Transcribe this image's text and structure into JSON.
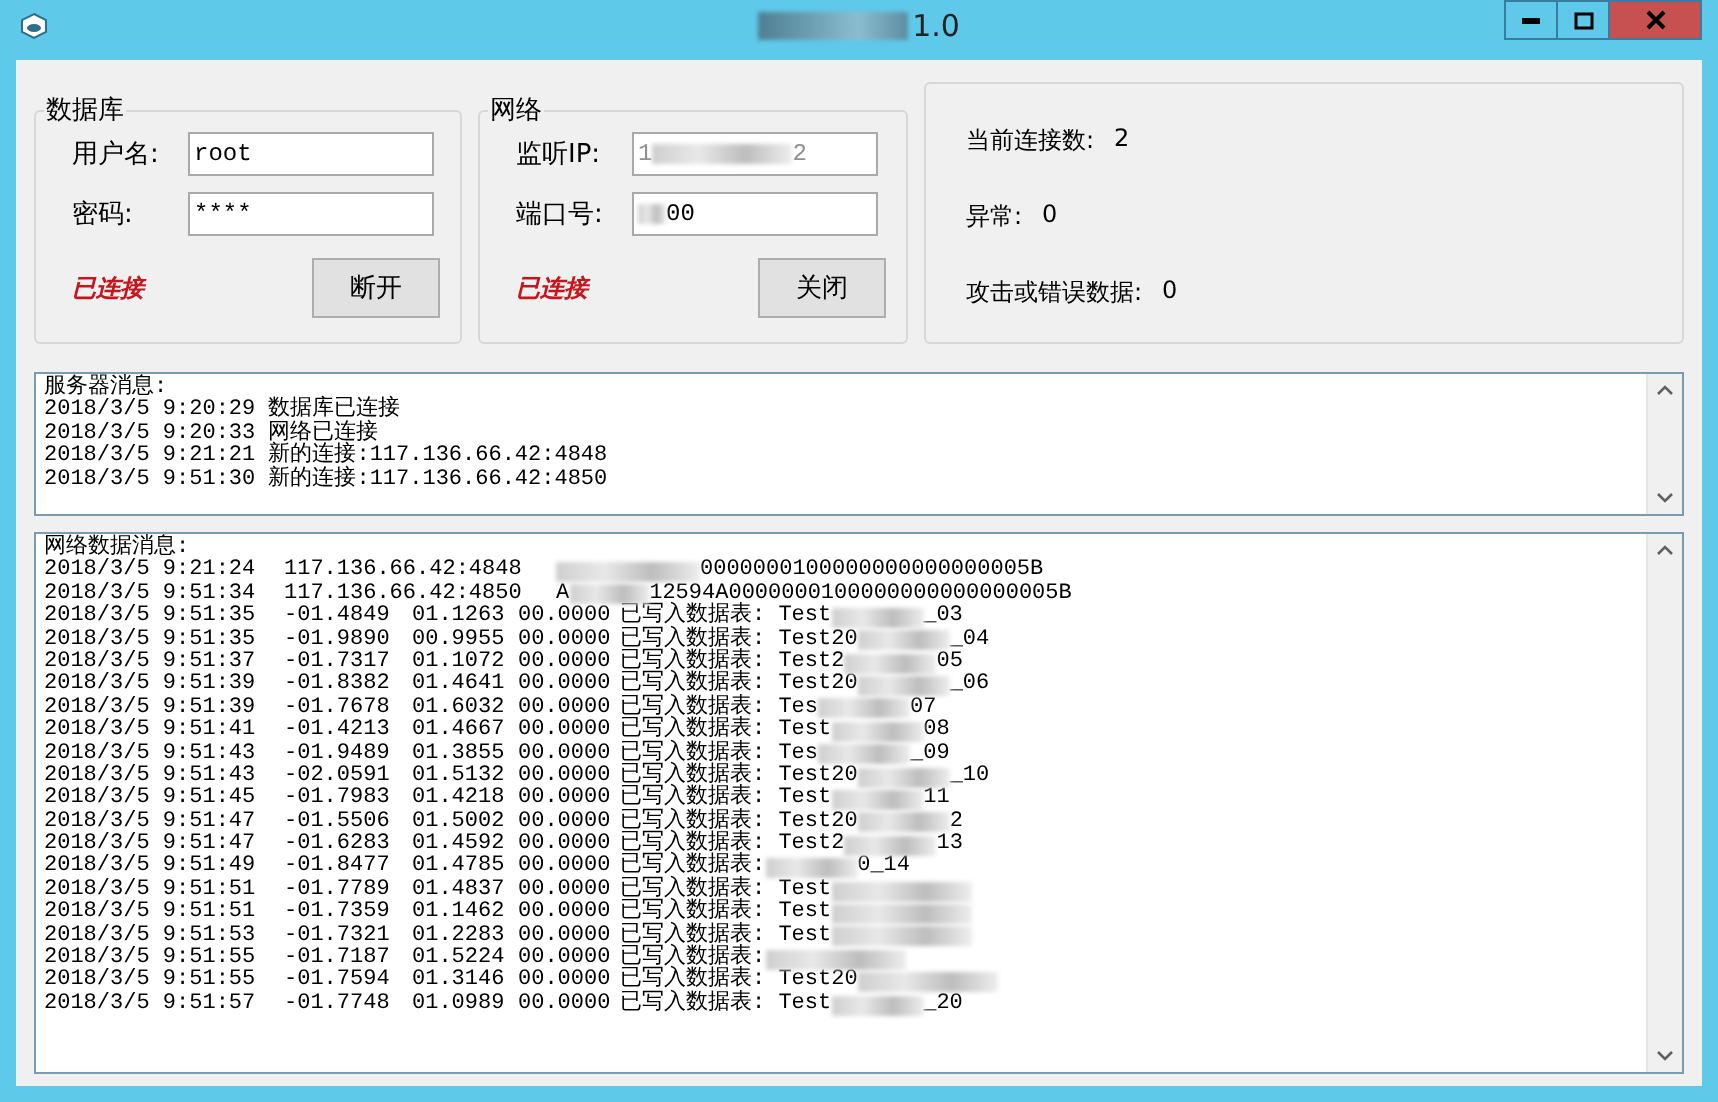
{
  "window": {
    "title": "1.0"
  },
  "database": {
    "title": "数据库",
    "username_label": "用户名:",
    "username": "root",
    "password_label": "密码:",
    "password": "****",
    "status": "已连接",
    "button": "断开"
  },
  "network": {
    "title": "网络",
    "ip_label": "监听IP:",
    "ip_parts": [
      "1",
      "2"
    ],
    "port_label": "端口号:",
    "port_value": "00",
    "status": "已连接",
    "button": "关闭"
  },
  "stats": [
    {
      "label": "当前连接数:",
      "value": "2"
    },
    {
      "label": "异常:",
      "value": "0"
    },
    {
      "label": "攻击或错误数据:",
      "value": "0"
    }
  ],
  "server_log": [
    "服务器消息:",
    "2018/3/5 9:20:29 数据库已连接",
    "2018/3/5 9:20:33 网络已连接",
    "2018/3/5 9:21:21 新的连接:117.136.66.42:4848",
    "2018/3/5 9:51:30 新的连接:117.136.66.42:4850"
  ],
  "network_log": {
    "title": "网络数据消息:",
    "rows": [
      {
        "kind": "packet",
        "time": "2018/3/5 9:21:24",
        "addr": "117.136.66.42:4848",
        "pre": "",
        "data": "0000000100000000000000005B"
      },
      {
        "kind": "packet",
        "time": "2018/3/5 9:51:34",
        "addr": "117.136.66.42:4850",
        "pre": "A",
        "data": "12594A0000000100000000000000005B"
      },
      {
        "kind": "record",
        "time": "2018/3/5 9:51:35",
        "v1": "-01.4849",
        "v2": "01.1263",
        "v3": "00.0000",
        "msg": "已写入数据表: Test",
        "suffix": "_03"
      },
      {
        "kind": "record",
        "time": "2018/3/5 9:51:35",
        "v1": "-01.9890",
        "v2": "00.9955",
        "v3": "00.0000",
        "msg": "已写入数据表: Test20",
        "suffix": "_04"
      },
      {
        "kind": "record",
        "time": "2018/3/5 9:51:37",
        "v1": "-01.7317",
        "v2": "01.1072",
        "v3": "00.0000",
        "msg": "已写入数据表: Test2",
        "suffix": "05"
      },
      {
        "kind": "record",
        "time": "2018/3/5 9:51:39",
        "v1": "-01.8382",
        "v2": "01.4641",
        "v3": "00.0000",
        "msg": "已写入数据表: Test20",
        "suffix": "_06"
      },
      {
        "kind": "record",
        "time": "2018/3/5 9:51:39",
        "v1": "-01.7678",
        "v2": "01.6032",
        "v3": "00.0000",
        "msg": "已写入数据表: Tes",
        "suffix": "07"
      },
      {
        "kind": "record",
        "time": "2018/3/5 9:51:41",
        "v1": "-01.4213",
        "v2": "01.4667",
        "v3": "00.0000",
        "msg": "已写入数据表: Test",
        "suffix": "08"
      },
      {
        "kind": "record",
        "time": "2018/3/5 9:51:43",
        "v1": "-01.9489",
        "v2": "01.3855",
        "v3": "00.0000",
        "msg": "已写入数据表: Tes",
        "suffix": "_09"
      },
      {
        "kind": "record",
        "time": "2018/3/5 9:51:43",
        "v1": "-02.0591",
        "v2": "01.5132",
        "v3": "00.0000",
        "msg": "已写入数据表: Test20",
        "suffix": "_10"
      },
      {
        "kind": "record",
        "time": "2018/3/5 9:51:45",
        "v1": "-01.7983",
        "v2": "01.4218",
        "v3": "00.0000",
        "msg": "已写入数据表: Test",
        "suffix": "11"
      },
      {
        "kind": "record",
        "time": "2018/3/5 9:51:47",
        "v1": "-01.5506",
        "v2": "01.5002",
        "v3": "00.0000",
        "msg": "已写入数据表: Test20",
        "suffix": "2"
      },
      {
        "kind": "record",
        "time": "2018/3/5 9:51:47",
        "v1": "-01.6283",
        "v2": "01.4592",
        "v3": "00.0000",
        "msg": "已写入数据表: Test2",
        "suffix": "13"
      },
      {
        "kind": "record",
        "time": "2018/3/5 9:51:49",
        "v1": "-01.8477",
        "v2": "01.4785",
        "v3": "00.0000",
        "msg": "已写入数据表:",
        "suffix": "0_14"
      },
      {
        "kind": "record",
        "time": "2018/3/5 9:51:51",
        "v1": "-01.7789",
        "v2": "01.4837",
        "v3": "00.0000",
        "msg": "已写入数据表: Test"
      },
      {
        "kind": "record",
        "time": "2018/3/5 9:51:51",
        "v1": "-01.7359",
        "v2": "01.1462",
        "v3": "00.0000",
        "msg": "已写入数据表: Test"
      },
      {
        "kind": "record",
        "time": "2018/3/5 9:51:53",
        "v1": "-01.7321",
        "v2": "01.2283",
        "v3": "00.0000",
        "msg": "已写入数据表: Test"
      },
      {
        "kind": "record",
        "time": "2018/3/5 9:51:55",
        "v1": "-01.7187",
        "v2": "01.5224",
        "v3": "00.0000",
        "msg": "已写入数据表:"
      },
      {
        "kind": "record",
        "time": "2018/3/5 9:51:55",
        "v1": "-01.7594",
        "v2": "01.3146",
        "v3": "00.0000",
        "msg": "已写入数据表: Test20"
      },
      {
        "kind": "record",
        "time": "2018/3/5 9:51:57",
        "v1": "-01.7748",
        "v2": "01.0989",
        "v3": "00.0000",
        "msg": "已写入数据表: Test",
        "suffix": "_20"
      }
    ]
  }
}
